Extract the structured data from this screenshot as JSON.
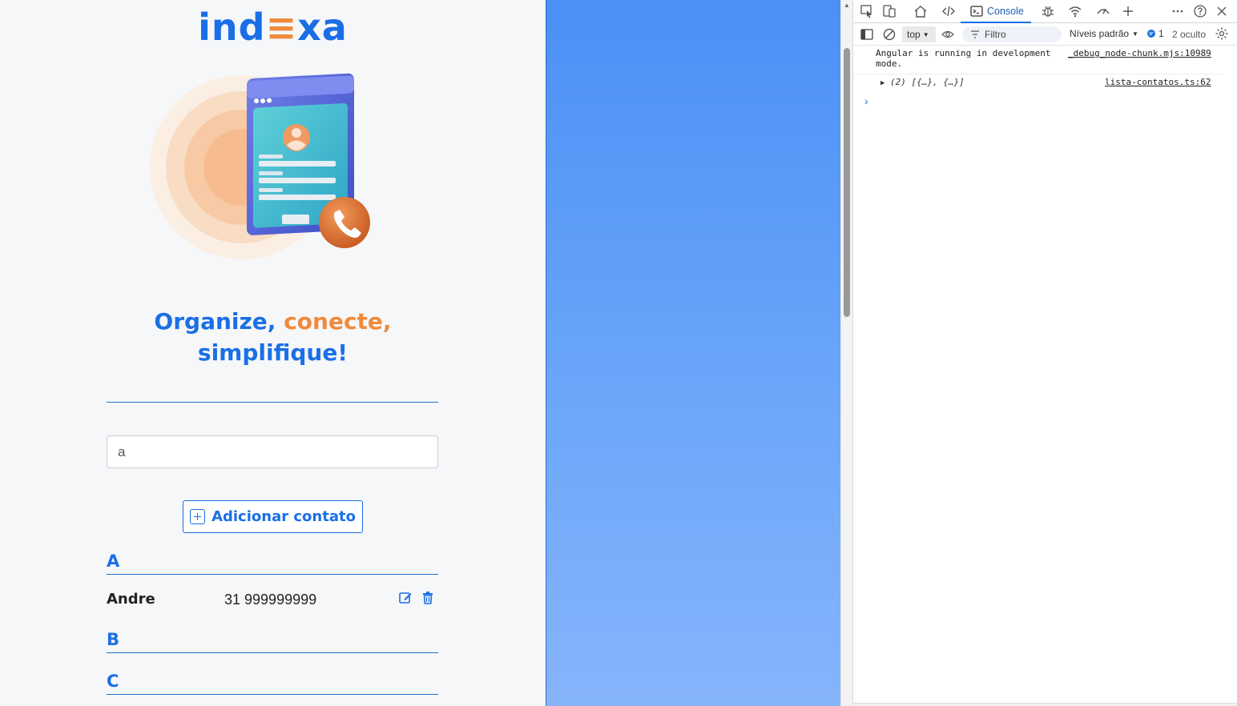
{
  "app": {
    "logo": {
      "part1": "ind",
      "part2": "≡",
      "part3": "xa"
    },
    "slogan": {
      "part1": "Organize,",
      "part2": "conecte,",
      "part3": "simplifique!"
    },
    "search": {
      "value": "a",
      "placeholder": ""
    },
    "add_button": {
      "label": "Adicionar contato"
    },
    "sections": [
      {
        "letter": "A"
      },
      {
        "letter": "B"
      },
      {
        "letter": "C"
      }
    ],
    "contacts": [
      {
        "name": "Andre",
        "phone": "31 999999999"
      }
    ]
  },
  "devtools": {
    "tabs": {
      "console": "Console"
    },
    "context": "top",
    "filter_placeholder": "Filtro",
    "levels_label": "Níveis padrão",
    "issues_count": "1",
    "hidden_label": "2 oculto",
    "messages": [
      {
        "text_line1": "Angular is running in development",
        "text_line2": "mode.",
        "source": "_debug_node-chunk.mjs:10989"
      },
      {
        "text": "(2) [{…}, {…}]",
        "source": "lista-contatos.ts:62"
      }
    ]
  },
  "colors": {
    "brand_blue": "#1a6fe6",
    "brand_orange": "#f08a3b",
    "panel_gradient_top": "#4a90f5",
    "panel_gradient_bottom": "#87b4fb"
  }
}
